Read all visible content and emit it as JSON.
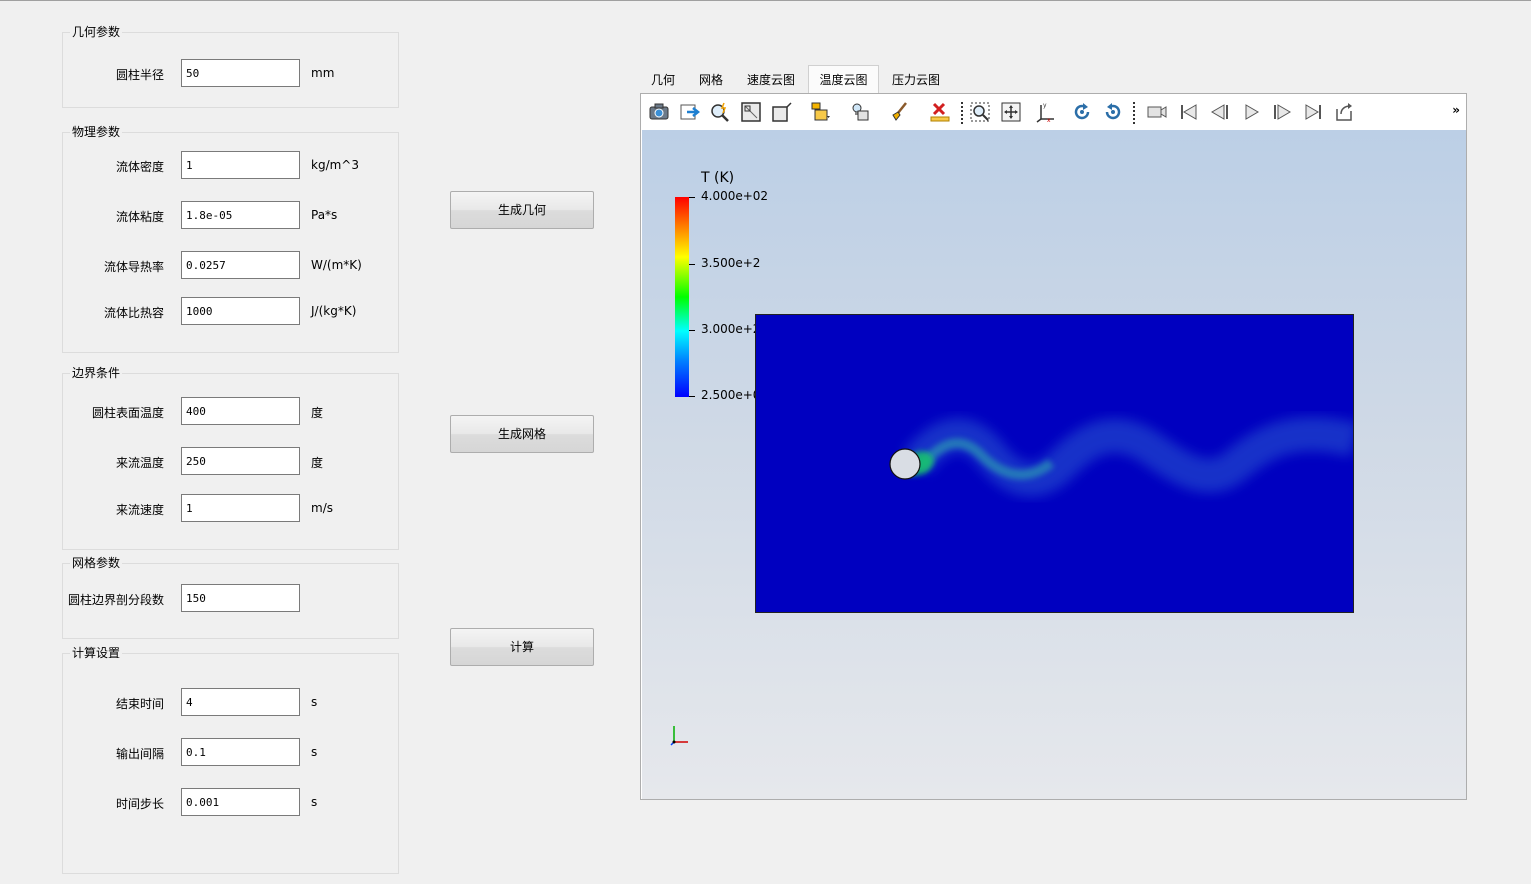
{
  "groups": {
    "geometry": {
      "title": "几何参数",
      "fields": [
        {
          "label": "圆柱半径",
          "value": "50",
          "unit": "mm"
        }
      ]
    },
    "physics": {
      "title": "物理参数",
      "fields": [
        {
          "label": "流体密度",
          "value": "1",
          "unit": "kg/m^3"
        },
        {
          "label": "流体粘度",
          "value": "1.8e-05",
          "unit": "Pa*s"
        },
        {
          "label": "流体导热率",
          "value": "0.0257",
          "unit": "W/(m*K)"
        },
        {
          "label": "流体比热容",
          "value": "1000",
          "unit": "J/(kg*K)"
        }
      ]
    },
    "boundary": {
      "title": "边界条件",
      "fields": [
        {
          "label": "圆柱表面温度",
          "value": "400",
          "unit": "度"
        },
        {
          "label": "来流温度",
          "value": "250",
          "unit": "度"
        },
        {
          "label": "来流速度",
          "value": "1",
          "unit": "m/s"
        }
      ]
    },
    "mesh": {
      "title": "网格参数",
      "fields": [
        {
          "label": "圆柱边界剖分段数",
          "value": "150"
        }
      ]
    },
    "compute": {
      "title": "计算设置",
      "fields": [
        {
          "label": "结束时间",
          "value": "4",
          "unit": "s"
        },
        {
          "label": "输出间隔",
          "value": "0.1",
          "unit": "s"
        },
        {
          "label": "时间步长",
          "value": "0.001",
          "unit": "s"
        }
      ]
    }
  },
  "buttons": {
    "gen_geometry": "生成几何",
    "gen_mesh": "生成网格",
    "compute": "计算"
  },
  "tabs": [
    "几何",
    "网格",
    "速度云图",
    "温度云图",
    "压力云图"
  ],
  "active_tab": "温度云图",
  "toolbar_icons": [
    "camera-icon",
    "export-icon",
    "zoom-query-icon",
    "reset-camera-icon",
    "parallel-projection-icon",
    "cube-view-icon",
    "light-bulb-icon",
    "brush-icon",
    "clear-icon",
    "zoom-box-icon",
    "fit-view-icon",
    "axes-icon",
    "rotate-cw-icon",
    "rotate-ccw-icon",
    "video-camera-icon",
    "first-frame-icon",
    "prev-frame-icon",
    "play-icon",
    "next-frame-icon",
    "last-frame-icon",
    "loop-icon"
  ],
  "toolbar_more": "»",
  "colorbar": {
    "title": "T (K)",
    "ticks": [
      "4.000e+02",
      "3.500e+2",
      "3.000e+2",
      "2.500e+02"
    ],
    "colors": [
      "#ff0000",
      "#ffff00",
      "#00ff00",
      "#00ffff",
      "#0000ff"
    ]
  },
  "colors": {
    "domain": "#0000c0",
    "accent_background": "#f0f0f0"
  }
}
